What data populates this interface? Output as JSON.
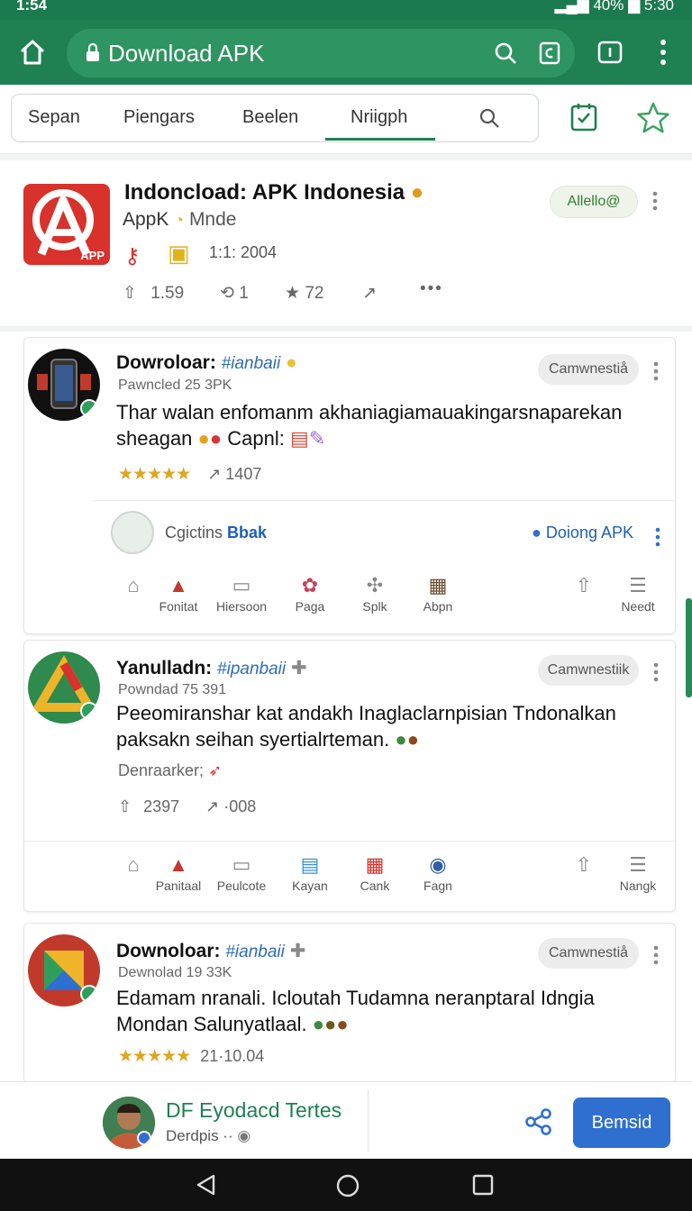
{
  "status_bar": {
    "left": "1:54",
    "battery": "40%",
    "time": "5:30"
  },
  "browser": {
    "url": "Download APK"
  },
  "tabs": [
    {
      "label": "Sepan"
    },
    {
      "label": "Piengars"
    },
    {
      "label": "Beelen"
    },
    {
      "label": "Nriigph"
    }
  ],
  "app": {
    "title": "Indoncload: APK Indonesia",
    "publisher": "AppK",
    "publisher_extra": "Mnde",
    "logo_text": "APP",
    "meta": "1:1: 2004",
    "pill": "Allello@",
    "actions": {
      "likes": "1.59",
      "reposts": "1",
      "rating": "72"
    }
  },
  "posts": [
    {
      "name": "Dowroloar:",
      "handle": "#ianbaii",
      "meta": "Pawncled 25 3PK",
      "body": "Thar walan enfomanm akhaniagiamauakingarsnaparekan sheagan",
      "body_tail": "Capnl:",
      "pill": "Camwnestiå",
      "stars": "★★★★★",
      "shares": "1407",
      "sub": {
        "name_prefix": "Cgictins",
        "name_bold": "Bbak",
        "right": "Doiong APK"
      },
      "actions": [
        "Fonitat",
        "Hiersoon",
        "Paga",
        "Splk",
        "Abpn",
        "Needt"
      ]
    },
    {
      "name": "Yanulladn:",
      "handle": "#ipanbaii",
      "meta": "Powndad 75 391",
      "body": "Peeomiranshar kat andakh Inaglaclarnpisian Tndonalkan paksakn seihan syertialrteman.",
      "extra": "Denraarker;",
      "pill": "Camwnestiik",
      "likes": "2397",
      "shares": "·008",
      "actions": [
        "Panitaal",
        "Peulcote",
        "Kayan",
        "Cank",
        "Fagn",
        "Nangk"
      ]
    },
    {
      "name": "Downoloar:",
      "handle": "#ianbaii",
      "meta": "Dewnolad 19 33K",
      "body": "Edamam nranali. Icloutah Tudamna neranptaral Idngia Mondan Salunyatlaal.",
      "pill": "Camwnestiå",
      "stars": "★★★★★",
      "stats": "21·10.04"
    }
  ],
  "bottom": {
    "name": "DF Eyodacd Tertes",
    "sub": "Derdpis ··",
    "button": "Bemsid"
  }
}
